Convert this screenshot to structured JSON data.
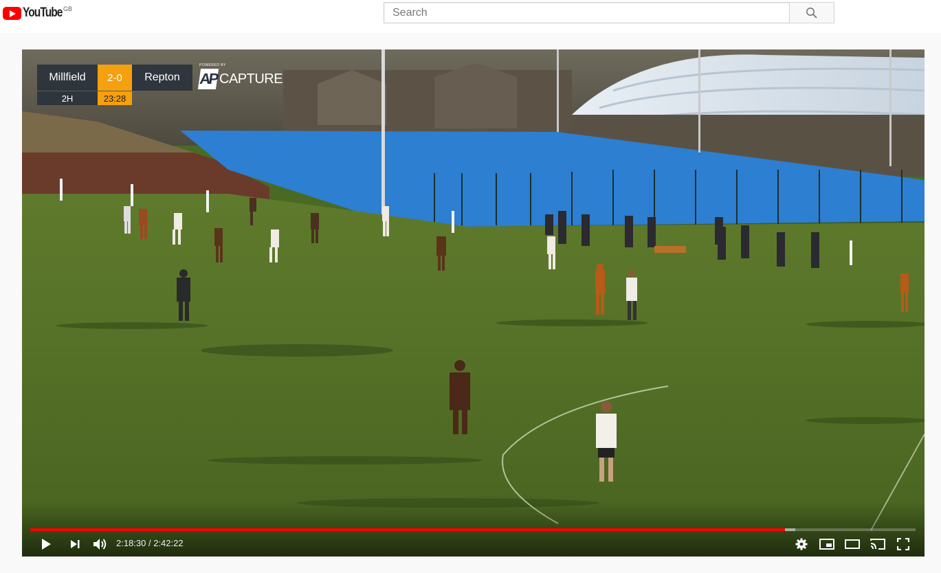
{
  "masthead": {
    "logo_text": "YouTube",
    "country_code": "GB",
    "search_placeholder": "Search"
  },
  "video": {
    "scoreboard": {
      "home_team": "Millfield",
      "score": "2-0",
      "away_team": "Repton",
      "period": "2H",
      "clock": "23:28"
    },
    "overlay_brand": {
      "prefix": "POWERED BY",
      "mark": "AP",
      "text": "CAPTURE"
    },
    "player": {
      "current_time": "2:18:30",
      "separator": " / ",
      "duration": "2:42:22",
      "progress_fraction": 0.8524,
      "buffered_fraction": 0.8645
    },
    "controls": {
      "play_icon": "play-icon",
      "next_icon": "next-icon",
      "volume_icon": "volume-icon",
      "settings_icon": "gear-icon",
      "miniplayer_icon": "miniplayer-icon",
      "theater_icon": "theater-icon",
      "cast_icon": "cast-icon",
      "fullscreen_icon": "fullscreen-icon"
    },
    "colors": {
      "progress": "#ff0000",
      "score_accent": "#f5a00e",
      "youtube_red": "#ff0000"
    }
  }
}
